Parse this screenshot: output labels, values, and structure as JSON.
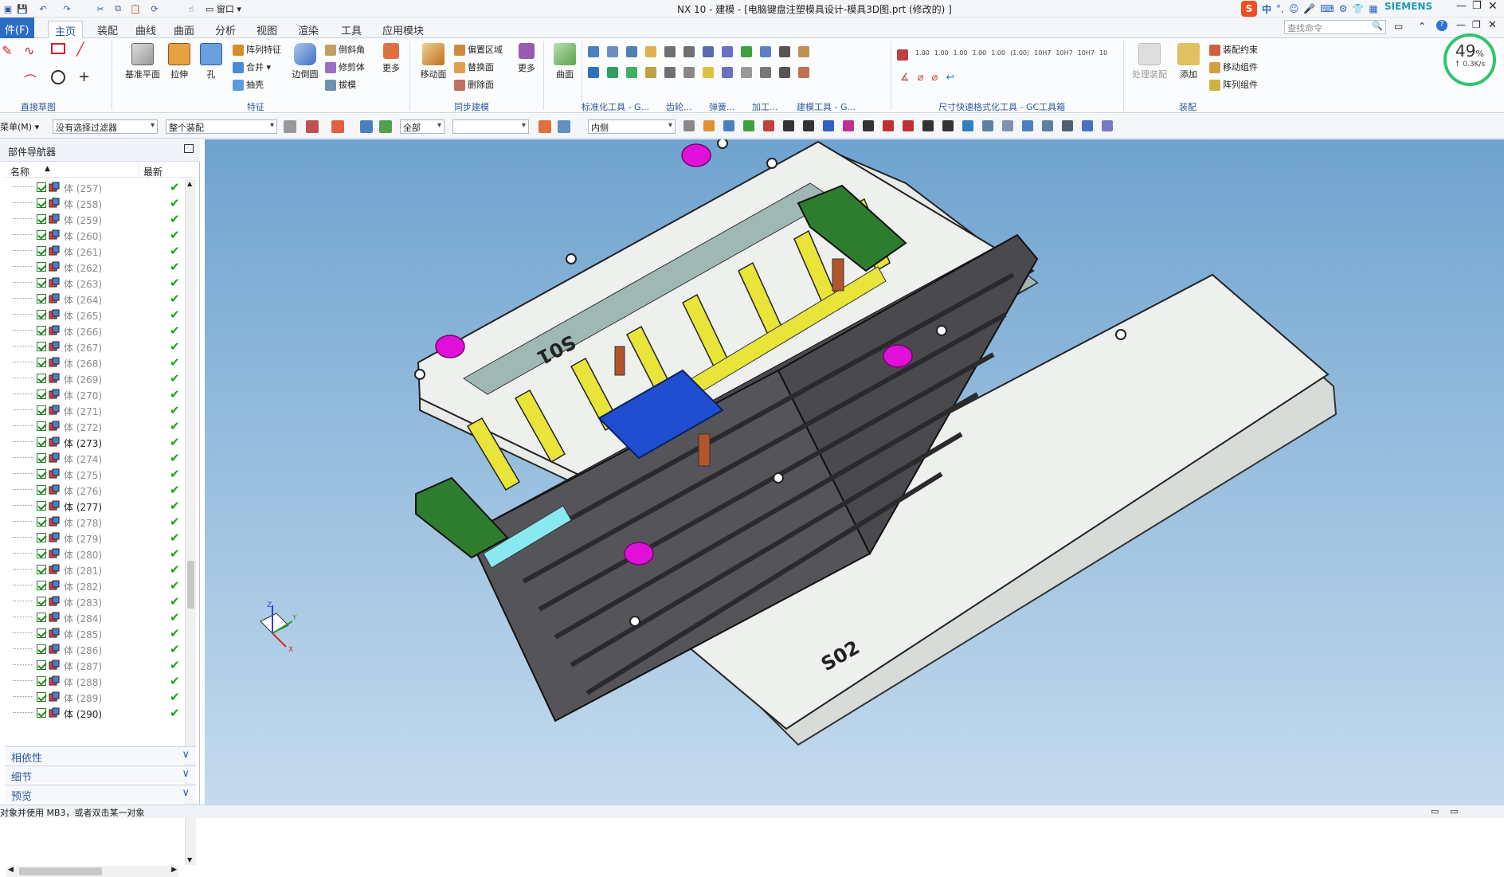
{
  "window": {
    "title": "NX 10 - 建模 - [电脑键盘注塑模具设计-模具3D图.prt  (修改的) ]",
    "brand": "SIEMENS",
    "window_menu": "窗口",
    "search_placeholder": "查找命令"
  },
  "ime": {
    "lang": "中",
    "punct": "°,"
  },
  "menu": {
    "file": "件(F)",
    "tabs": [
      "主页",
      "装配",
      "曲线",
      "曲面",
      "分析",
      "视图",
      "渲染",
      "工具",
      "应用模块"
    ],
    "active": "主页"
  },
  "ribbon": {
    "groups": {
      "sketch": "直接草图",
      "feature": "特征",
      "sync": "同步建模",
      "std": "标准化工具 - G...",
      "gear": "齿轮...",
      "spring": "弹簧...",
      "process": "加工...",
      "build": "建模工具 - G...",
      "dim": "尺寸快速格式化工具 - GC工具箱",
      "assembly": "装配"
    },
    "buttons": {
      "datum_plane": "基准平面",
      "extrude": "拉伸",
      "hole": "孔",
      "pattern_feature": "阵列特征",
      "unite": "合并",
      "shell": "抽壳",
      "edge_blend": "边倒圆",
      "chamfer": "倒斜角",
      "trim_body": "修剪体",
      "draft": "拔模",
      "more1": "更多",
      "move_face": "移动面",
      "offset_region": "偏置区域",
      "replace_face": "替换面",
      "delete_face": "删除面",
      "more2": "更多",
      "surface": "曲面",
      "process_assembly": "处理装配",
      "add": "添加",
      "assembly_constraint": "装配约束",
      "move_component": "移动组件",
      "pattern_component": "阵列组件"
    },
    "dim_labels": [
      "1.00",
      "1.00",
      "1.00",
      "1.00",
      "1.00",
      "(1.00)",
      "10H7",
      "10H7",
      "10H7",
      "10"
    ]
  },
  "filterbar": {
    "menu": "菜单(M)",
    "filter": "没有选择过滤器",
    "scope": "整个装配",
    "all": "全部",
    "blank": "",
    "inside": "内侧"
  },
  "navigator": {
    "title": "部件导航器",
    "col_name": "名称",
    "col_latest": "最新",
    "rows": [
      {
        "label": "体 (257)",
        "dim": true
      },
      {
        "label": "体 (258)",
        "dim": true
      },
      {
        "label": "体 (259)",
        "dim": true
      },
      {
        "label": "体 (260)",
        "dim": true
      },
      {
        "label": "体 (261)",
        "dim": true
      },
      {
        "label": "体 (262)",
        "dim": true
      },
      {
        "label": "体 (263)",
        "dim": true
      },
      {
        "label": "体 (264)",
        "dim": true
      },
      {
        "label": "体 (265)",
        "dim": true
      },
      {
        "label": "体 (266)",
        "dim": true
      },
      {
        "label": "体 (267)",
        "dim": true
      },
      {
        "label": "体 (268)",
        "dim": true
      },
      {
        "label": "体 (269)",
        "dim": true
      },
      {
        "label": "体 (270)",
        "dim": true
      },
      {
        "label": "体 (271)",
        "dim": true
      },
      {
        "label": "体 (272)",
        "dim": true
      },
      {
        "label": "体 (273)",
        "dim": false
      },
      {
        "label": "体 (274)",
        "dim": true
      },
      {
        "label": "体 (275)",
        "dim": true
      },
      {
        "label": "体 (276)",
        "dim": true
      },
      {
        "label": "体 (277)",
        "dim": false
      },
      {
        "label": "体 (278)",
        "dim": true
      },
      {
        "label": "体 (279)",
        "dim": true
      },
      {
        "label": "体 (280)",
        "dim": true
      },
      {
        "label": "体 (281)",
        "dim": true
      },
      {
        "label": "体 (282)",
        "dim": true
      },
      {
        "label": "体 (283)",
        "dim": true
      },
      {
        "label": "体 (284)",
        "dim": true
      },
      {
        "label": "体 (285)",
        "dim": true
      },
      {
        "label": "体 (286)",
        "dim": true
      },
      {
        "label": "体 (287)",
        "dim": true
      },
      {
        "label": "体 (288)",
        "dim": true
      },
      {
        "label": "体 (289)",
        "dim": true
      },
      {
        "label": "体 (290)",
        "dim": false
      }
    ],
    "panels": [
      "相依性",
      "细节",
      "预览"
    ]
  },
  "model": {
    "plate_top_label": "S01",
    "plate_bottom_label": "S02",
    "colors": {
      "plate": "#eef0ee",
      "frame": "#4a4a4e",
      "slider": "#e8e43a",
      "pin": "#e010d8",
      "block": "#2e7d2e",
      "insert": "#1f4fd0",
      "cyan": "#8ae8f0"
    }
  },
  "gauge": {
    "percent": "49",
    "unit": "%",
    "rate": "0.3K/s"
  },
  "status": {
    "text": "对象并使用 MB3，或者双击某一对象"
  },
  "axes": {
    "x": "X",
    "y": "Y",
    "z": "Z"
  }
}
